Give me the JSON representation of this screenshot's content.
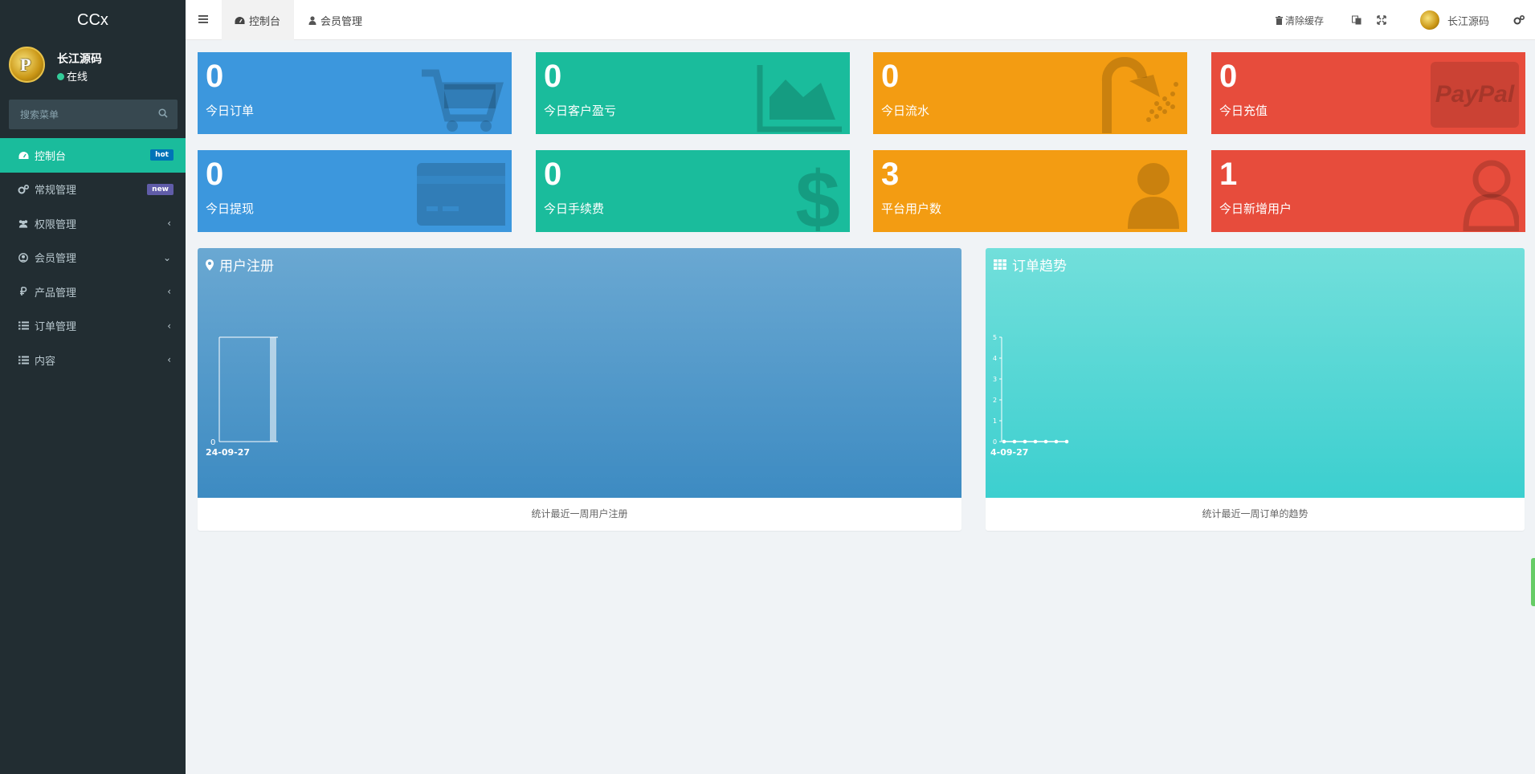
{
  "sidebar": {
    "brand": "CCx",
    "user": {
      "name": "长江源码",
      "status": "在线",
      "avatar_letter": "P"
    },
    "search": {
      "placeholder": "搜索菜单"
    },
    "items": [
      {
        "label": "控制台",
        "icon": "dashboard-icon",
        "badge": "hot",
        "active": true
      },
      {
        "label": "常规管理",
        "icon": "cogs-icon",
        "badge": "new"
      },
      {
        "label": "权限管理",
        "icon": "users-icon",
        "chevron": "‹"
      },
      {
        "label": "会员管理",
        "icon": "user-circle-icon",
        "chevron": "⌄"
      },
      {
        "label": "产品管理",
        "icon": "ruble-icon",
        "chevron": "‹"
      },
      {
        "label": "订单管理",
        "icon": "list-icon",
        "chevron": "‹"
      },
      {
        "label": "内容",
        "icon": "list-icon",
        "chevron": "‹"
      }
    ]
  },
  "topbar": {
    "tabs": [
      {
        "label": "控制台",
        "icon": "dashboard-icon",
        "active": true
      },
      {
        "label": "会员管理",
        "icon": "user-icon"
      }
    ],
    "clear_cache": "清除缓存",
    "username": "长江源码"
  },
  "cards": [
    {
      "value": "0",
      "label": "今日订单",
      "color": "#3c97dd",
      "icon": "cart-icon"
    },
    {
      "value": "0",
      "label": "今日客户盈亏",
      "color": "#1abc9c",
      "icon": "area-chart-icon"
    },
    {
      "value": "0",
      "label": "今日流水",
      "color": "#f39c12",
      "icon": "shower-icon"
    },
    {
      "value": "0",
      "label": "今日充值",
      "color": "#e74c3c",
      "icon": "paypal-icon",
      "icon_text": "PayPal"
    },
    {
      "value": "0",
      "label": "今日提现",
      "color": "#3c97dd",
      "icon": "credit-card-icon"
    },
    {
      "value": "0",
      "label": "今日手续费",
      "color": "#1abc9c",
      "icon": "dollar-icon"
    },
    {
      "value": "3",
      "label": "平台用户数",
      "color": "#f39c12",
      "icon": "user-icon"
    },
    {
      "value": "1",
      "label": "今日新增用户",
      "color": "#e74c3c",
      "icon": "user-outline-icon"
    }
  ],
  "panels": [
    {
      "title": "用户注册",
      "icon": "map-marker-icon",
      "footer": "统计最近一周用户注册"
    },
    {
      "title": "订单趋势",
      "icon": "grid-icon",
      "footer": "统计最近一周订单的趋势"
    }
  ],
  "chart_data": [
    {
      "type": "bar",
      "categories": [
        "24-09-27"
      ],
      "values": [
        1
      ],
      "xtick_label": "24-09-27",
      "ytick_label": "0",
      "ylim": [
        0,
        1
      ]
    },
    {
      "type": "line",
      "x": [
        "4-09-27",
        "",
        "",
        "",
        "",
        "",
        ""
      ],
      "values": [
        0,
        0,
        0,
        0,
        0,
        0,
        0
      ],
      "xtick_label": "4-09-27",
      "yticks": [
        "0",
        "1",
        "2",
        "3",
        "4",
        "5"
      ],
      "ylim": [
        0,
        5
      ]
    }
  ]
}
